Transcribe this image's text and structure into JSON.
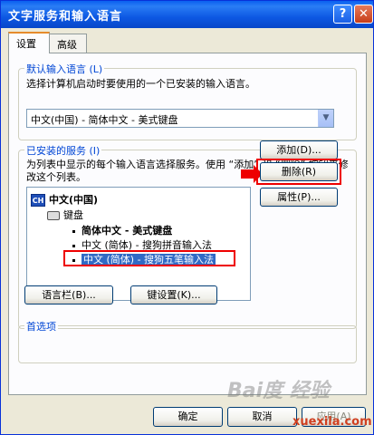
{
  "window": {
    "title": "文字服务和输入语言",
    "help": "?",
    "close": "✕"
  },
  "tabs": [
    {
      "label": "设置"
    },
    {
      "label": "高级"
    }
  ],
  "default_lang": {
    "group_title": "默认输入语言 (L)",
    "description": "选择计算机启动时要使用的一个已安装的输入语言。",
    "combo_value": "中文(中国) - 简体中文 - 美式键盘",
    "combo_arrow": "▼"
  },
  "services": {
    "group_title": "已安装的服务 (I)",
    "description": "为列表中显示的每个输入语言选择服务。使用 “添加” 和 “删除” 按钮来修改这个列表。",
    "tree": {
      "lang_badge": "CH",
      "language": "中文(中国)",
      "category": "键盘",
      "items": [
        "简体中文 - 美式键盘",
        "中文 (简体) - 搜狗拼音输入法",
        "中文 (简体) - 搜狗五笔输入法"
      ]
    },
    "buttons": {
      "add": "添加(D)...",
      "remove": "删除(R)",
      "properties": "属性(P)..."
    }
  },
  "preferences": {
    "group_title": "首选项",
    "buttons": {
      "language_bar": "语言栏(B)...",
      "key_settings": "键设置(K)..."
    }
  },
  "footer": {
    "ok": "确定",
    "cancel": "取消",
    "apply": "应用(A)"
  },
  "watermark": {
    "logo": "Bai度 经验",
    "url": "xuexila.com"
  }
}
